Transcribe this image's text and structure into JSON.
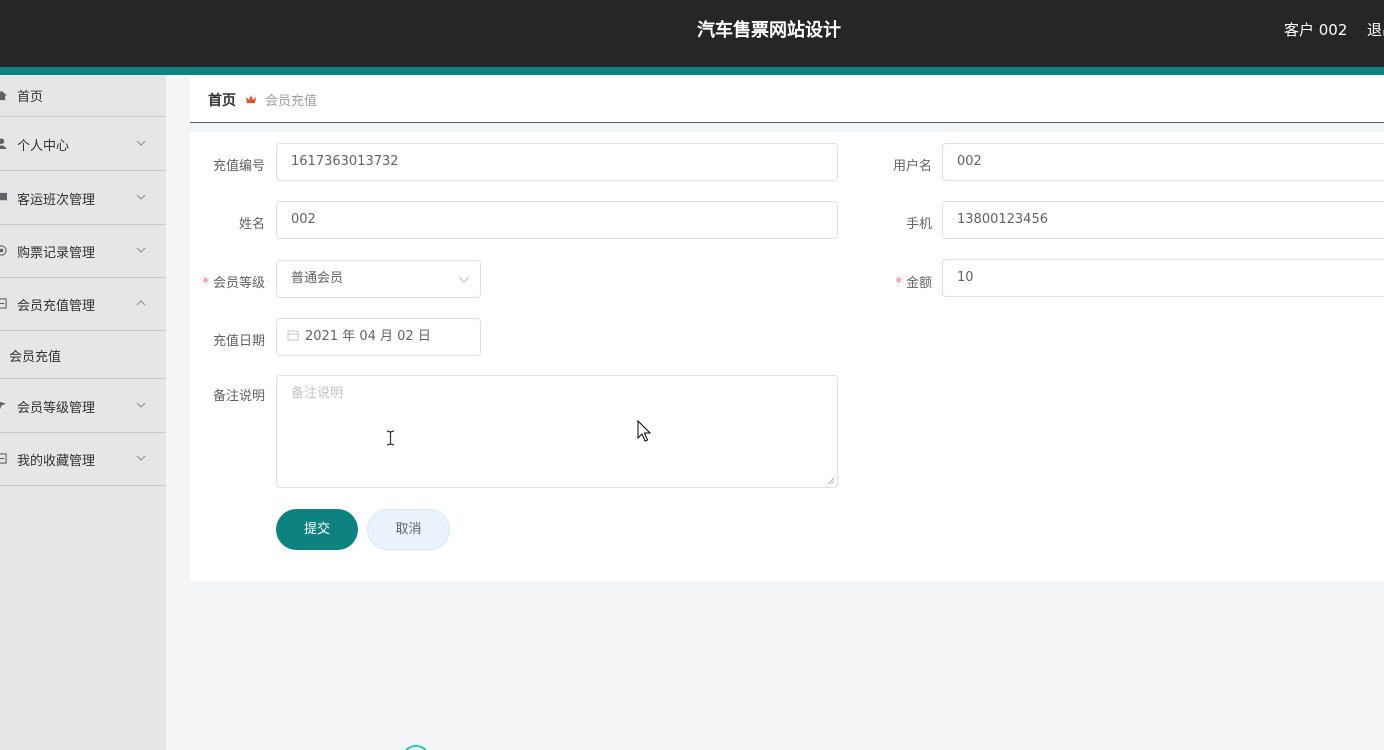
{
  "header": {
    "title": "汽车售票网站设计",
    "user": "客户 002",
    "logout": "退出"
  },
  "colors": {
    "primary": "#0d8280",
    "header_bg": "#262626",
    "sidebar_bg": "#e6e6e6",
    "required": "#f56c6c",
    "breadcrumb_icon": "#e6501e"
  },
  "sidebar": {
    "items": [
      {
        "label": "首页",
        "icon": "home-icon"
      },
      {
        "label": "个人中心",
        "icon": "user-icon"
      },
      {
        "label": "客运班次管理",
        "icon": "bus-icon"
      },
      {
        "label": "购票记录管理",
        "icon": "ticket-icon"
      },
      {
        "label": "会员充值管理",
        "icon": "wallet-icon",
        "expanded": true
      },
      {
        "label": "会员等级管理",
        "icon": "flag-icon"
      },
      {
        "label": "我的收藏管理",
        "icon": "star-icon"
      }
    ],
    "submenu": {
      "label": "会员充值"
    }
  },
  "breadcrumb": {
    "home": "首页",
    "current": "会员充值"
  },
  "form": {
    "recharge_no": {
      "label": "充值编号",
      "value": "1617363013732"
    },
    "username": {
      "label": "用户名",
      "value": "002"
    },
    "name": {
      "label": "姓名",
      "value": "002"
    },
    "phone": {
      "label": "手机",
      "value": "13800123456"
    },
    "member_level": {
      "label": "会员等级",
      "value": "普通会员",
      "required": true
    },
    "amount": {
      "label": "金额",
      "value": "10",
      "required": true
    },
    "date": {
      "label": "充值日期",
      "value": "2021 年 04 月 02 日"
    },
    "remark": {
      "label": "备注说明",
      "placeholder": "备注说明"
    },
    "submit": "提交",
    "cancel": "取消"
  }
}
